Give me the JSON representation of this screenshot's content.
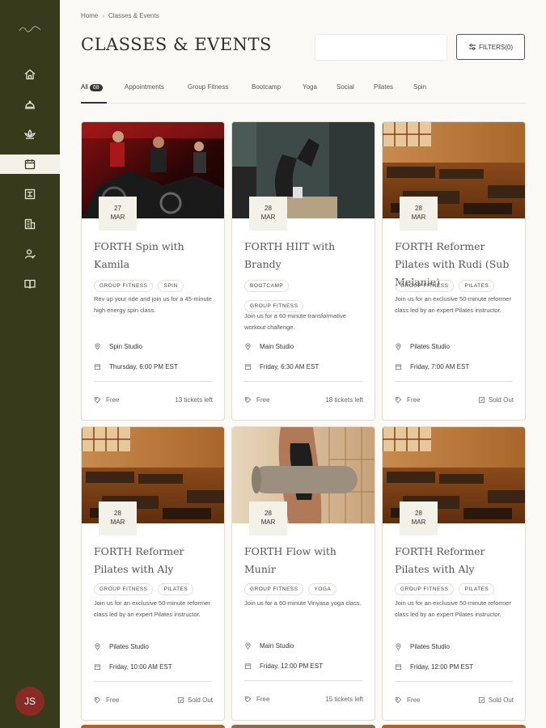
{
  "breadcrumb": {
    "home": "Home",
    "current": "Classes & Events"
  },
  "page_title": "CLASSES & EVENTS",
  "search": {
    "value": ""
  },
  "filters_label": "FILTERS(0)",
  "user_initials": "JS",
  "tabs": [
    {
      "label": "All",
      "count": "68"
    },
    {
      "label": "Appointments"
    },
    {
      "label": "Group Fitness"
    },
    {
      "label": "Bootcamp"
    },
    {
      "label": "Yoga"
    },
    {
      "label": "Social"
    },
    {
      "label": "Pilates"
    },
    {
      "label": "Spin"
    }
  ],
  "cards": [
    {
      "day": "27",
      "month": "MAR",
      "title": "FORTH Spin with Kamila",
      "tags": [
        "GROUP FITNESS",
        "SPIN"
      ],
      "description": "Rev up your ride and join us for a 45-minute high energy spin class.",
      "location": "Spin Studio",
      "time": "Thursday, 6:00 PM EST",
      "price": "Free",
      "availability": "13 tickets left",
      "sold_out": false,
      "image": "spin-class-photo"
    },
    {
      "day": "28",
      "month": "MAR",
      "title": "FORTH HIIT with Brandy",
      "tags": [
        "BOOTCAMP",
        "GROUP FITNESS"
      ],
      "description": "Join us for a 60-minute transformative workout challenge.",
      "location": "Main Studio",
      "time": "Friday, 6:30 AM EST",
      "price": "Free",
      "availability": "18 tickets left",
      "sold_out": false,
      "image": "hiit-box-jump-photo"
    },
    {
      "day": "28",
      "month": "MAR",
      "title": "FORTH Reformer Pilates with Rudi (Sub Melanie)",
      "tags": [
        "GROUP FITNESS",
        "PILATES"
      ],
      "description": "Join us for an exclusive 50-minute reformer class led by an expert Pilates instructor.",
      "location": "Pilates Studio",
      "time": "Friday, 7:00 AM EST",
      "price": "Free",
      "availability": "Sold Out",
      "sold_out": true,
      "image": "pilates-studio-photo"
    },
    {
      "day": "28",
      "month": "MAR",
      "title": "FORTH Reformer Pilates with Aly",
      "tags": [
        "GROUP FITNESS",
        "PILATES"
      ],
      "description": "Join us for an exclusive 50-minute reformer class led by an expert Pilates instructor.",
      "location": "Pilates Studio",
      "time": "Friday, 10:00 AM EST",
      "price": "Free",
      "availability": "Sold Out",
      "sold_out": true,
      "image": "pilates-studio-photo"
    },
    {
      "day": "28",
      "month": "MAR",
      "title": "FORTH Flow with Munir",
      "tags": [
        "GROUP FITNESS",
        "YOGA"
      ],
      "description": "Join us for a 60-minute Vinyasa yoga class.",
      "location": "Main Studio",
      "time": "Friday, 12:00 PM EST",
      "price": "Free",
      "availability": "15 tickets left",
      "sold_out": false,
      "image": "yoga-mat-photo"
    },
    {
      "day": "28",
      "month": "MAR",
      "title": "FORTH Reformer Pilates with Aly",
      "tags": [
        "GROUP FITNESS",
        "PILATES"
      ],
      "description": "Join us for an exclusive 50-minute reformer class led by an expert Pilates instructor.",
      "location": "Pilates Studio",
      "time": "Friday, 12:00 PM EST",
      "price": "Free",
      "availability": "Sold Out",
      "sold_out": true,
      "image": "pilates-studio-photo"
    }
  ],
  "nav_icons": [
    "home-icon",
    "dining-icon",
    "spa-icon",
    "calendar-icon",
    "gym-icon",
    "building-icon",
    "members-icon",
    "book-icon"
  ]
}
